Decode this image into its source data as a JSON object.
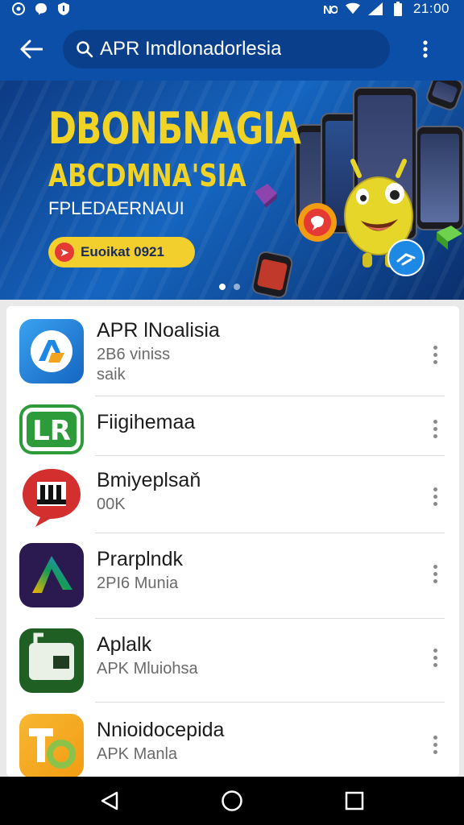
{
  "status_bar": {
    "time": "21:00",
    "left_icons": [
      "notification-icon",
      "messenger-icon",
      "shield-icon"
    ],
    "right_icons": [
      "nfc-icon",
      "wifi-icon",
      "signal-icon",
      "battery-icon"
    ]
  },
  "app_bar": {
    "search_query": "APR Imdlonadorlesia",
    "icons": {
      "back": "arrow-left-icon",
      "search": "search-icon",
      "more": "more-vert-icon"
    }
  },
  "banner": {
    "title": "DBONБNAGIA",
    "subtitle": "ABCDMNA'SIA",
    "tagline": "FPLEDAERNAUI",
    "cta_label": "Euoikat 0921",
    "slides": 2,
    "active_slide": 1
  },
  "apps": [
    {
      "name": "APR lNoalisia",
      "line1": "2B6 viniss",
      "line2": "saik",
      "icon": "app-icon-blue-letters",
      "color": "#1e88e5"
    },
    {
      "name": "Fiigihemaa",
      "line1": "",
      "line2": "",
      "icon": "app-icon-lr",
      "color": "#2e9b3a"
    },
    {
      "name": "Bmiyeplsaň",
      "line1": "00K",
      "line2": "",
      "icon": "app-icon-red-bubble",
      "color": "#d32f2f"
    },
    {
      "name": "Prarplndk",
      "line1": "2PI6 Munia",
      "line2": "",
      "icon": "app-icon-gradient-triangle",
      "color": "#3f2a78"
    },
    {
      "name": "Aplalk",
      "line1": "APK Mluiohsa",
      "line2": "",
      "icon": "app-icon-green-box",
      "color": "#2e7d32"
    },
    {
      "name": "Nnioidocepida",
      "line1": "APK Manla",
      "line2": "",
      "icon": "app-icon-orange-ta",
      "color": "#f39c12"
    }
  ],
  "nav_bar": {
    "icons": [
      "back-triangle-icon",
      "home-circle-icon",
      "recents-square-icon"
    ]
  }
}
